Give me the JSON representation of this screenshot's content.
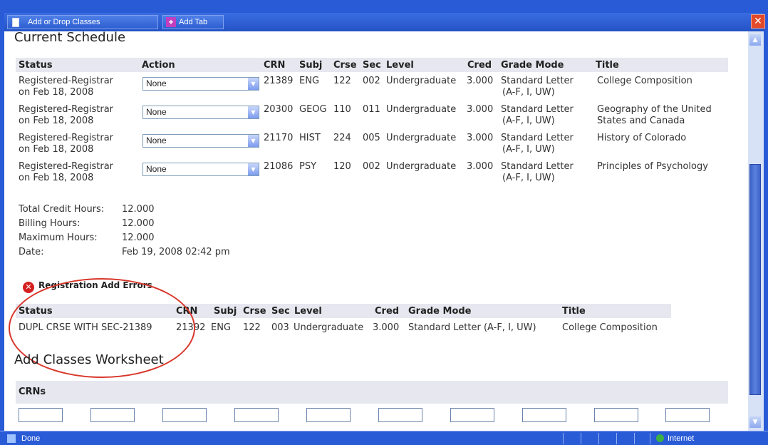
{
  "tabs": [
    {
      "label": "Add or Drop Classes",
      "icon": "document-icon"
    },
    {
      "label": "Add Tab",
      "icon": "plus-icon"
    }
  ],
  "schedule": {
    "title": "Current Schedule",
    "headers": [
      "Status",
      "Action",
      "CRN",
      "Subj",
      "Crse",
      "Sec",
      "Level",
      "Cred",
      "Grade Mode",
      "Title"
    ],
    "rows": [
      {
        "status1": "Registered-Registrar",
        "status2": "on Feb 18, 2008",
        "action": "None",
        "crn": "21389",
        "subj": "ENG",
        "crse": "122",
        "sec": "002",
        "level": "Undergraduate",
        "cred": "3.000",
        "grade1": "Standard Letter",
        "grade2": "(A-F, I, UW)",
        "title1": "College Composition",
        "title2": ""
      },
      {
        "status1": "Registered-Registrar",
        "status2": "on Feb 18, 2008",
        "action": "None",
        "crn": "20300",
        "subj": "GEOG",
        "crse": "110",
        "sec": "011",
        "level": "Undergraduate",
        "cred": "3.000",
        "grade1": "Standard Letter",
        "grade2": "(A-F, I, UW)",
        "title1": "Geography of the United",
        "title2": "States and Canada"
      },
      {
        "status1": "Registered-Registrar",
        "status2": "on Feb 18, 2008",
        "action": "None",
        "crn": "21170",
        "subj": "HIST",
        "crse": "224",
        "sec": "005",
        "level": "Undergraduate",
        "cred": "3.000",
        "grade1": "Standard Letter",
        "grade2": "(A-F, I, UW)",
        "title1": "History of Colorado",
        "title2": ""
      },
      {
        "status1": "Registered-Registrar",
        "status2": "on Feb 18, 2008",
        "action": "None",
        "crn": "21086",
        "subj": "PSY",
        "crse": "120",
        "sec": "002",
        "level": "Undergraduate",
        "cred": "3.000",
        "grade1": "Standard Letter",
        "grade2": "(A-F, I, UW)",
        "title1": "Principles of Psychology",
        "title2": ""
      }
    ]
  },
  "totals": {
    "total_label": "Total Credit Hours:",
    "total_value": "12.000",
    "billing_label": "Billing Hours:",
    "billing_value": "12.000",
    "max_label": "Maximum Hours:",
    "max_value": "12.000",
    "date_label": "Date:",
    "date_value": "Feb 19, 2008 02:42 pm"
  },
  "errors": {
    "title": "Registration Add Errors",
    "headers": [
      "Status",
      "CRN",
      "Subj",
      "Crse",
      "Sec",
      "Level",
      "Cred",
      "Grade Mode",
      "Title"
    ],
    "row": {
      "status": "DUPL CRSE WITH SEC-21389",
      "crn": "21392",
      "subj": "ENG",
      "crse": "122",
      "sec": "003",
      "level": "Undergraduate",
      "cred": "3.000",
      "grade": "Standard Letter (A-F, I, UW)",
      "title": "College Composition"
    }
  },
  "worksheet": {
    "title": "Add Classes Worksheet",
    "crns_label": "CRNs",
    "crn_inputs": [
      "",
      "",
      "",
      "",
      "",
      "",
      "",
      "",
      "",
      ""
    ]
  },
  "statusbar": {
    "text": "Done",
    "zone": "Internet"
  },
  "colors": {
    "frame": "#2a5bd7",
    "header_bg": "#e6e7ef",
    "annotation": "#d9362a"
  }
}
